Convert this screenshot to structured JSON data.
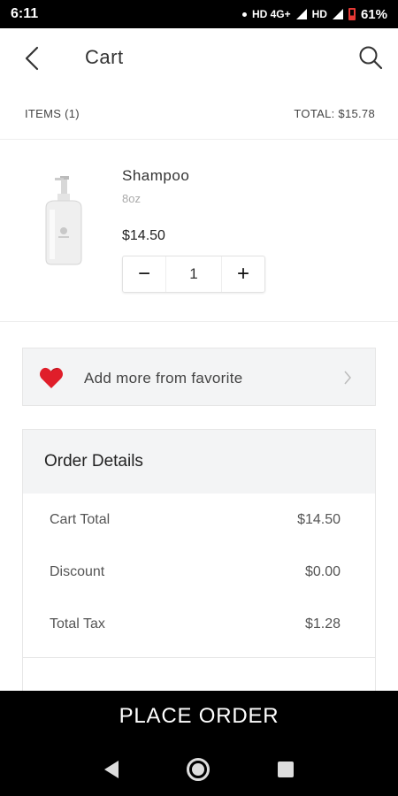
{
  "status_bar": {
    "time": "6:11",
    "network": "HD 4G+",
    "network2": "HD",
    "battery": "61%"
  },
  "header": {
    "title": "Cart",
    "back_icon": "back-arrow-icon",
    "search_icon": "search-icon"
  },
  "summary": {
    "items_label": "ITEMS (1)",
    "total_label": "TOTAL: $15.78"
  },
  "cart_items": [
    {
      "name": "Shampoo",
      "variant": "8oz",
      "price": "$14.50",
      "quantity": "1",
      "minus_symbol": "−",
      "plus_symbol": "+"
    }
  ],
  "favorites": {
    "label": "Add more from favorite",
    "icon": "heart-icon",
    "accent_color": "#e01e2a"
  },
  "order_details": {
    "title": "Order Details",
    "rows": [
      {
        "label": "Cart Total",
        "value": "$14.50"
      },
      {
        "label": "Discount",
        "value": "$0.00"
      },
      {
        "label": "Total Tax",
        "value": "$1.28"
      }
    ]
  },
  "footer": {
    "place_order_label": "PLACE ORDER"
  }
}
